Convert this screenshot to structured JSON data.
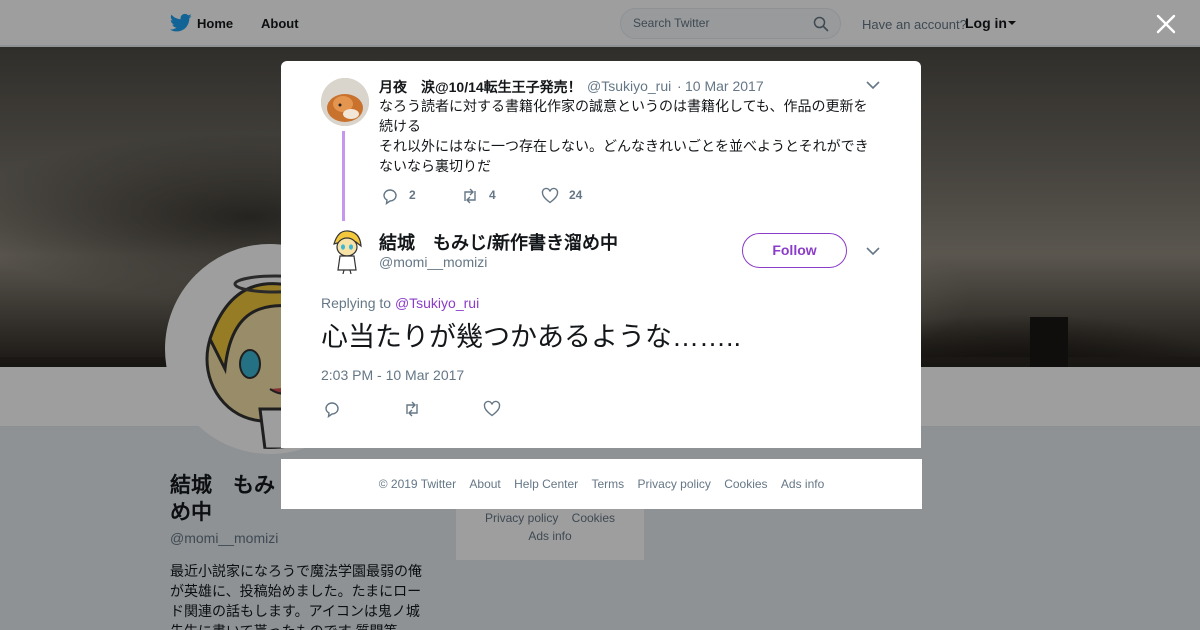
{
  "nav": {
    "home": "Home",
    "about": "About",
    "search_placeholder": "Search Twitter",
    "have_account": "Have an account?",
    "login": "Log in"
  },
  "profile": {
    "name": "結城　もみじ/新作書き溜め中",
    "name_visible": "結城　もみ\nめ中",
    "handle": "@momi__momizi",
    "bio": "最近小説家になろうで魔法学園最弱の俺が英雄に、投稿始めました。たまにロード関連の話もします。アイコンは鬼ノ城先生に書いて貰ったものです 質問等"
  },
  "side_card": {
    "row1": [
      "Privacy policy",
      "Cookies"
    ],
    "row2": "Ads info"
  },
  "parent_tweet": {
    "name": "月夜　涙@10/14転生王子発売！",
    "handle": "@Tsukiyo_rui",
    "separator": "·",
    "date": "10 Mar 2017",
    "text_line1": "なろう読者に対する書籍化作家の誠意というのは書籍化しても、作品の更新を",
    "text_line2": "続ける",
    "text_line3": "それ以外にはなに一つ存在しない。どんなきれいごとを並べようとそれができ",
    "text_line4": "ないなら裏切りだ",
    "replies": "2",
    "retweets": "4",
    "likes": "24"
  },
  "main_tweet": {
    "name": "結城　もみじ/新作書き溜め中",
    "handle": "@momi__momizi",
    "follow_label": "Follow",
    "replying_prefix": "Replying to",
    "replying_to": "@Tsukiyo_rui",
    "text": "心当たりが幾つかあるような……..",
    "timestamp": "2:03 PM - 10 Mar 2017"
  },
  "footer": {
    "links": [
      "© 2019 Twitter",
      "About",
      "Help Center",
      "Terms",
      "Privacy policy",
      "Cookies",
      "Ads info"
    ]
  },
  "colors": {
    "brand": "#1da1f2",
    "accent": "#8b3cc8",
    "thread": "#c597ef",
    "muted": "#657786"
  }
}
